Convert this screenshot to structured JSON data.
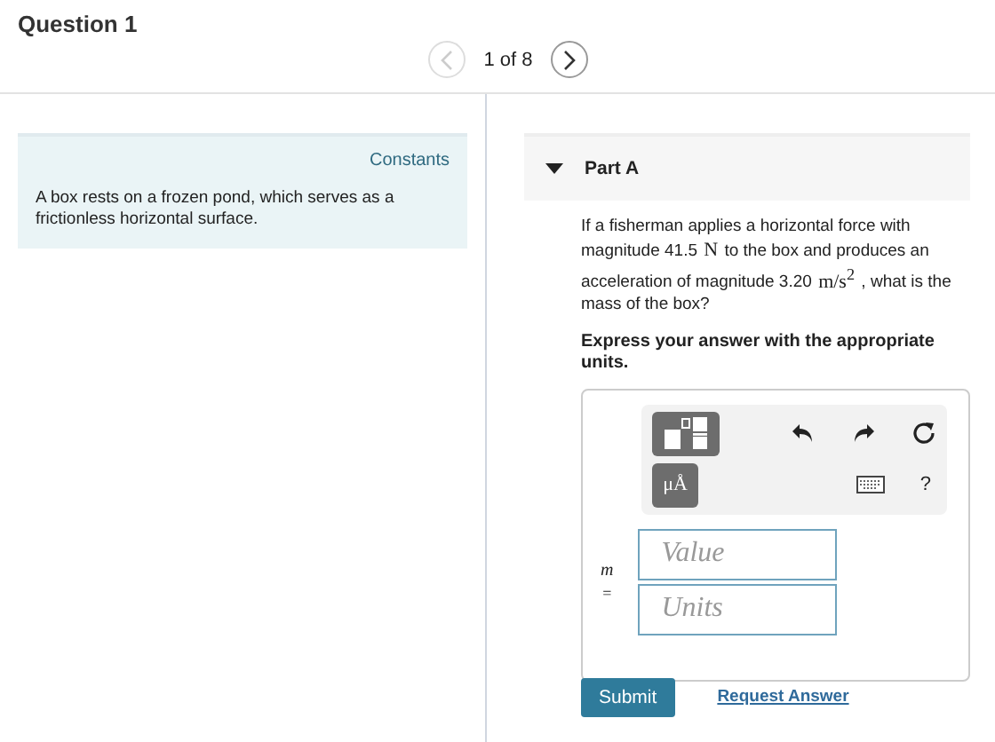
{
  "title": "Question 1",
  "pager": {
    "label": "1 of 8",
    "prev_disabled": true,
    "next_disabled": false
  },
  "constants": {
    "link": "Constants",
    "text": "A box rests on a frozen pond, which serves as a frictionless horizontal surface."
  },
  "part": {
    "title": "Part A",
    "expanded": true,
    "question": [
      {
        "kind": "text",
        "s": "If a fisherman applies a horizontal force with magnitude 41.5 "
      },
      {
        "kind": "math",
        "s": "N"
      },
      {
        "kind": "text",
        "s": " to the box and produces an acceleration of magnitude 3.20 "
      },
      {
        "kind": "math",
        "s": "m/s$^{2}$"
      },
      {
        "kind": "text",
        "s": " , what is the mass of the box?"
      }
    ],
    "instruction": "Express your answer with the appropriate units.",
    "units_button": "μÅ",
    "help": "?",
    "variable": "m",
    "equals": "=",
    "value_placeholder": "Value",
    "units_placeholder": "Units",
    "submit": "Submit",
    "request": "Request Answer"
  }
}
